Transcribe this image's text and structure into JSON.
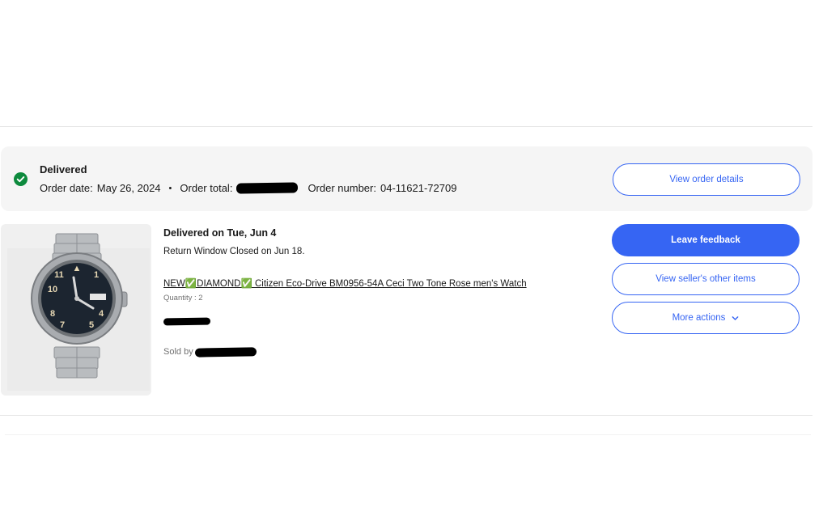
{
  "order": {
    "status": "Delivered",
    "order_date_label": "Order date:",
    "order_date": "May 26, 2024",
    "separator": "•",
    "order_total_label": "Order total:",
    "order_number_label": "Order number:",
    "order_number": "04-11621-72709",
    "view_order_details": "View order details",
    "status_color": "#0d8a3d"
  },
  "item": {
    "delivered_on": "Delivered on Tue, Jun 4",
    "return_window": "Return Window Closed on Jun 18.",
    "title": "NEW✅DIAMOND✅ Citizen Eco-Drive BM0956-54A Ceci Two Tone Rose men's Watch",
    "quantity": "Quantity : 2",
    "sold_by_label": "Sold by",
    "image_icon": "watch-product-image"
  },
  "actions": {
    "leave_feedback": "Leave feedback",
    "view_seller_items": "View seller's other items",
    "more_actions": "More actions"
  },
  "colors": {
    "accent": "#3665f3",
    "header_bg": "#f5f5f5"
  }
}
